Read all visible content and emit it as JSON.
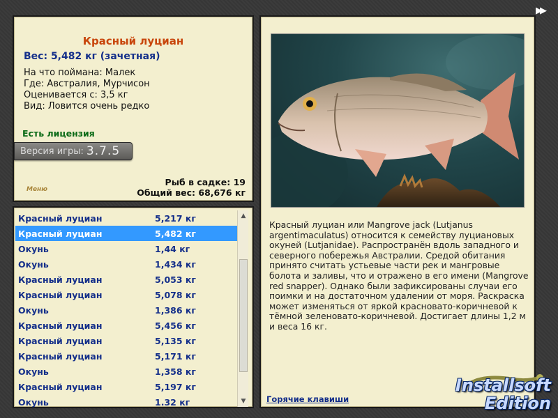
{
  "fish": {
    "name": "Красный луциан",
    "weight_line": "Вес: 5,482 кг (зачетная)",
    "props": [
      "На что поймана: Малек",
      "Где: Австралия, Мурчисон",
      "Оценивается с: 3,5 кг",
      "Вид: Ловится очень редко"
    ]
  },
  "license": "Есть лицензия",
  "version": {
    "label": "Версия игры:",
    "value": "3.7.5"
  },
  "menu_link": "Меню",
  "stats": {
    "fish_in_keepnet": "Рыб в садке: 19",
    "total_weight": "Общий вес: 68,676 кг"
  },
  "catch_list": [
    {
      "name": "Красный луциан",
      "weight": "5,217 кг"
    },
    {
      "name": "Красный луциан",
      "weight": "5,482 кг",
      "selected": true
    },
    {
      "name": "Окунь",
      "weight": "1,44 кг"
    },
    {
      "name": "Окунь",
      "weight": "1,434 кг"
    },
    {
      "name": "Красный луциан",
      "weight": "5,053 кг"
    },
    {
      "name": "Красный луциан",
      "weight": "5,078 кг"
    },
    {
      "name": "Окунь",
      "weight": "1,386 кг"
    },
    {
      "name": "Красный луциан",
      "weight": "5,456 кг"
    },
    {
      "name": "Красный луциан",
      "weight": "5,135 кг"
    },
    {
      "name": "Красный луциан",
      "weight": "5,171 кг"
    },
    {
      "name": "Окунь",
      "weight": "1,358 кг"
    },
    {
      "name": "Красный луциан",
      "weight": "5,197 кг"
    },
    {
      "name": "Окунь",
      "weight": "1.32 кг"
    }
  ],
  "description": "Красный луциан или Mangrove jack (Lutjanus argentimaculatus) относится к семейству луциановых окуней (Lutjanidae). Распространён вдоль западного и северного побережья Австралии. Средой обитания принято считать устьевые части рек и мангровые болота и заливы, что и отражено в его имени (Mangrove red snapper). Однако были зафиксированы случаи его поимки и на достаточном удалении от моря. Раскраска может изменяться от яркой красновато-коричневой к тёмной зеленовато-коричневой. Достигает длины 1,2 м и веса 16 кг.",
  "hotkeys_link": "Горячие клавиши",
  "watermark": {
    "line1": "Installsoft",
    "line2": "Edition"
  },
  "icons": {
    "forward": "fast-forward-icon",
    "scroll_up": "scroll-up-arrow-icon",
    "scroll_down": "scroll-down-arrow-icon"
  },
  "colors": {
    "title": "#c8460c",
    "value_text": "#142f8a",
    "license": "#0a6a16",
    "selection": "#3399ff",
    "panel": "#f3efcf"
  }
}
